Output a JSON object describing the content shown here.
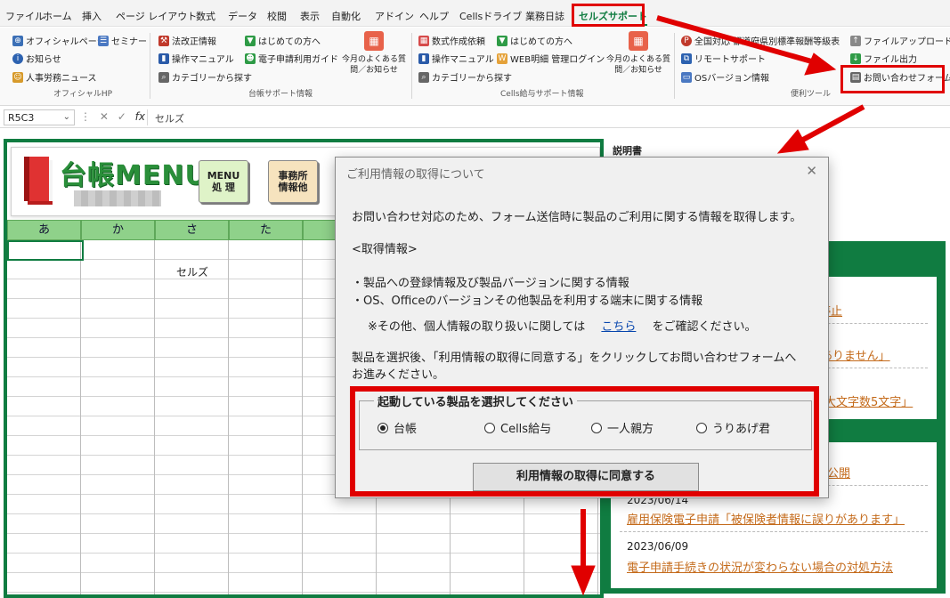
{
  "menubar": {
    "items": [
      {
        "label": "ファイル"
      },
      {
        "label": "ホーム"
      },
      {
        "label": "挿入"
      },
      {
        "label": "ページ レイアウト"
      },
      {
        "label": "数式"
      },
      {
        "label": "データ"
      },
      {
        "label": "校閲"
      },
      {
        "label": "表示"
      },
      {
        "label": "自動化"
      },
      {
        "label": "アドイン"
      },
      {
        "label": "ヘルプ"
      },
      {
        "label": "Cellsドライブ"
      },
      {
        "label": "業務日誌"
      },
      {
        "label": "セルズサポート"
      }
    ]
  },
  "ribbon": {
    "official": {
      "items": [
        "オフィシャルページ",
        "セミナー",
        "お知らせ",
        "人事労務ニュース"
      ],
      "group": "オフィシャルHP"
    },
    "daicho": {
      "items": [
        "法改正情報",
        "はじめての方へ",
        "操作マニュアル",
        "電子申請利用ガイド",
        "カテゴリーから探す"
      ],
      "faq": "今月のよくある質問／お知らせ",
      "group": "台帳サポート情報"
    },
    "cells": {
      "items": [
        "数式作成依頼",
        "はじめての方へ",
        "操作マニュアル",
        "WEB明細 管理ログイン",
        "カテゴリーから探す"
      ],
      "faq": "今月のよくある質問／お知らせ",
      "group": "Cells給与サポート情報"
    },
    "tools": {
      "items": [
        "全国対応 都道府県別標準報酬等級表",
        "ファイルアップロード",
        "リモートサポート",
        "ファイル出力",
        "OSバージョン情報",
        "お問い合わせフォーム"
      ],
      "group": "便利ツール"
    }
  },
  "formulabar": {
    "namebox": "R5C3",
    "fx": "fx",
    "content": "セルズ"
  },
  "sheet": {
    "logo": "台帳MENU",
    "menu_buttons": [
      "MENU\n処 理",
      "事務所\n情報他"
    ],
    "col_headers": [
      "あ",
      "か",
      "さ",
      "た"
    ],
    "cell_value": "セルズ",
    "side_title": "説明書",
    "side_links": [
      {
        "text": "停止"
      },
      {
        "text": "ありません」"
      },
      {
        "text": "大文字数5文字」"
      },
      {
        "text": "公開"
      }
    ],
    "news": [
      {
        "date": "2023/06/14",
        "text": "雇用保険電子申請「被保険者情報に誤りがあります」"
      },
      {
        "date": "2023/06/09",
        "text": "電子申請手続きの状況が変わらない場合の対処方法"
      }
    ]
  },
  "dialog": {
    "title": "ご利用情報の取得について",
    "close": "✕",
    "intro": "お問い合わせ対応のため、フォーム送信時に製品のご利用に関する情報を取得します。",
    "section": "<取得情報>",
    "bullet1": "・製品への登録情報及び製品バージョンに関する情報",
    "bullet2": "・OS、Officeのバージョンその他製品を利用する端末に関する情報",
    "note_before": "※その他、個人情報の取り扱いに関しては",
    "note_link": "こちら",
    "note_after": "をご確認ください。",
    "instruction1": "製品を選択後、「利用情報の取得に同意する」をクリックしてお問い合わせフォームへ",
    "instruction2": "お進みください。",
    "product_legend": "起動している製品を選択してください",
    "products": [
      {
        "label": "台帳",
        "selected": true
      },
      {
        "label": "Cells給与",
        "selected": false
      },
      {
        "label": "一人親方",
        "selected": false
      },
      {
        "label": "うりあげ君",
        "selected": false
      }
    ],
    "agree_button": "利用情報の取得に同意する"
  },
  "colors": {
    "accent_green": "#107c41",
    "highlight_red": "#e00000",
    "header_green": "#8fd18a",
    "link_orange": "#c46a1a"
  }
}
